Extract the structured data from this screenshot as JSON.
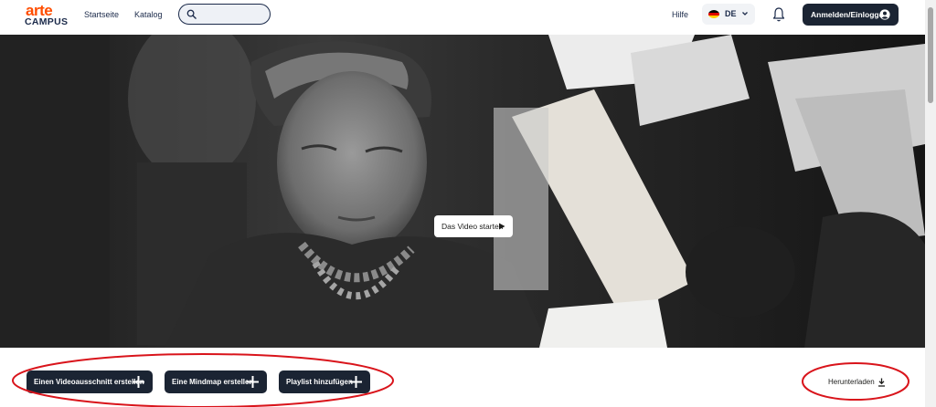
{
  "header": {
    "logo_top": "arte",
    "logo_bottom": "CAMPUS",
    "nav": [
      {
        "label": "Startseite"
      },
      {
        "label": "Katalog"
      }
    ],
    "search": {
      "placeholder": "",
      "value": ""
    },
    "help_label": "Hilfe",
    "language": {
      "code": "DE"
    },
    "login_label": "Anmelden/Einloggen"
  },
  "hero": {
    "play_label": "Das Video starten"
  },
  "actions": [
    {
      "label": "Einen Videoausschnitt erstellen"
    },
    {
      "label": "Eine Mindmap erstellen"
    },
    {
      "label": "Playlist hinzufügen"
    }
  ],
  "download_label": "Herunterladen",
  "colors": {
    "accent": "#ff4d00",
    "dark": "#1b2433",
    "annotation": "#d9141b"
  }
}
